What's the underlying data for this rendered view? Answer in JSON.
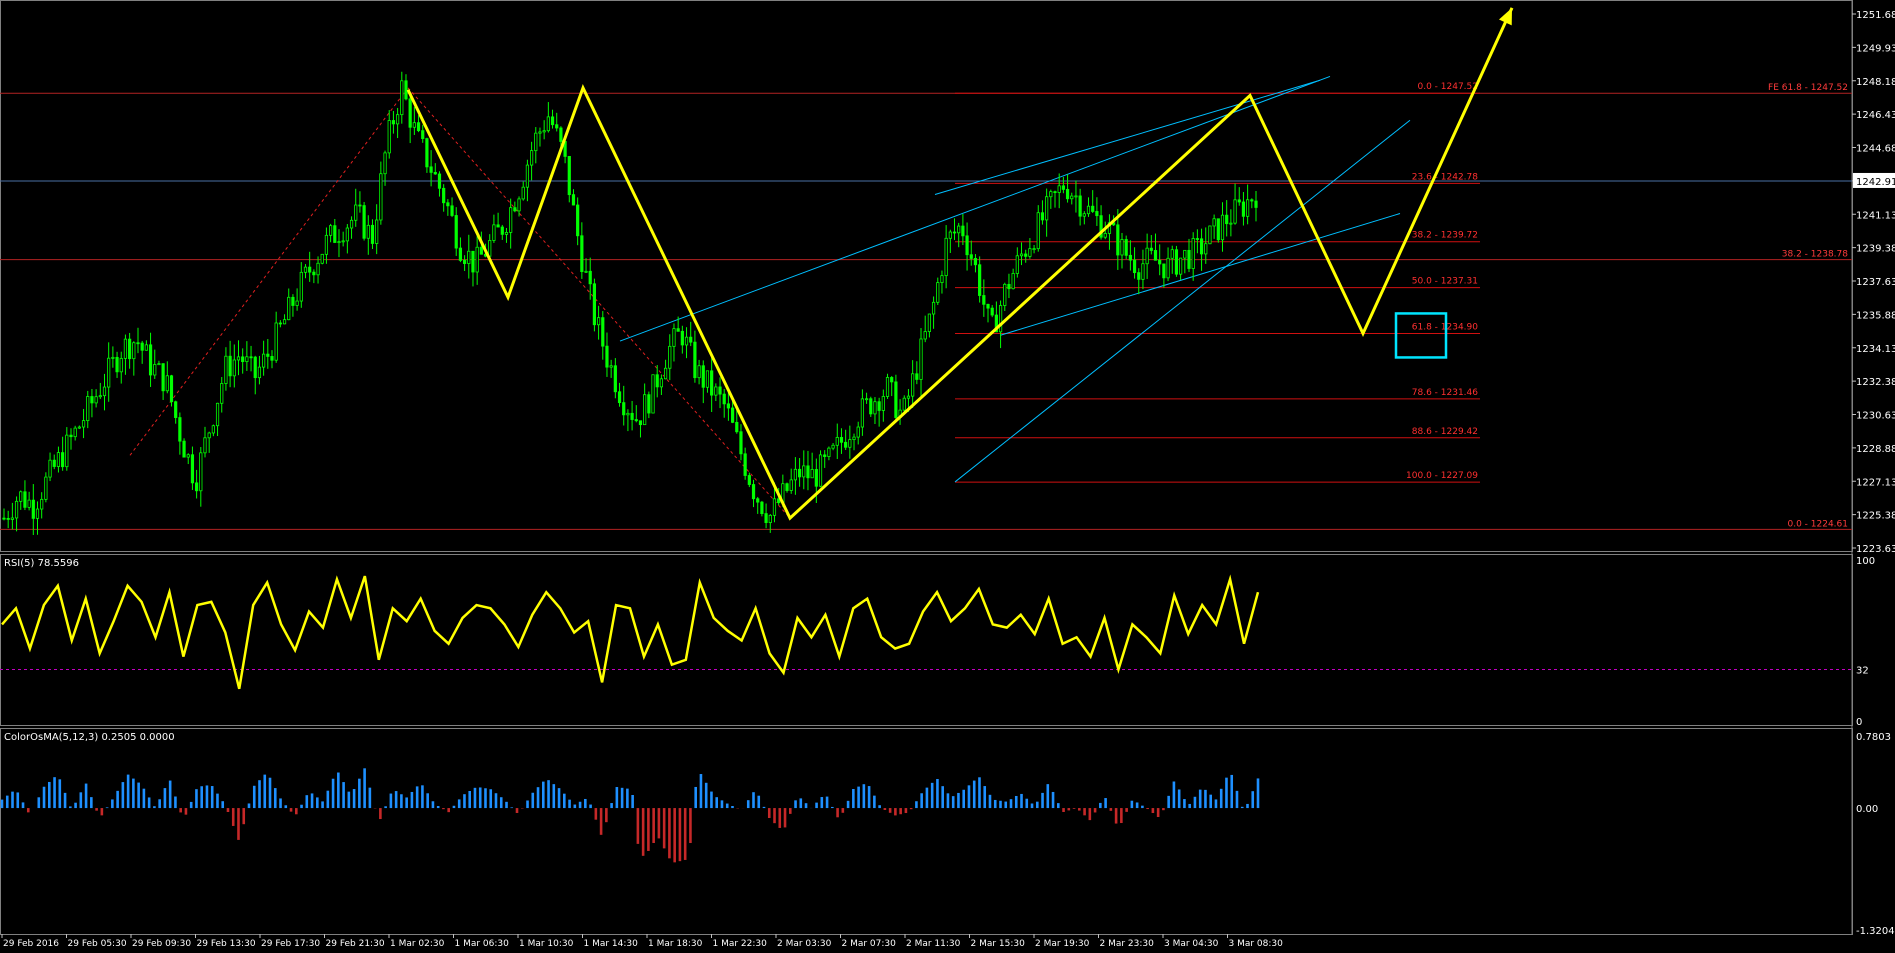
{
  "chart_data": [
    {
      "type": "candlestick",
      "title": "",
      "price_axis": {
        "min": 1223.63,
        "max": 1251.68,
        "ticks": [
          "1251.68",
          "1249.93",
          "1248.18",
          "1246.43",
          "1244.68",
          "1242.93",
          "1241.13",
          "1239.38",
          "1237.63",
          "1235.88",
          "1234.13",
          "1232.38",
          "1230.63",
          "1228.88",
          "1227.13",
          "1225.38",
          "1223.63"
        ],
        "current_price_label": "1242.91",
        "current_price": 1242.91
      },
      "time_axis": {
        "labels": [
          "29 Feb 2016",
          "29 Feb 05:30",
          "29 Feb 09:30",
          "29 Feb 13:30",
          "29 Feb 17:30",
          "29 Feb 21:30",
          "1 Mar 02:30",
          "1 Mar 06:30",
          "1 Mar 10:30",
          "1 Mar 14:30",
          "1 Mar 18:30",
          "1 Mar 22:30",
          "2 Mar 03:30",
          "2 Mar 07:30",
          "2 Mar 11:30",
          "2 Mar 15:30",
          "2 Mar 19:30",
          "2 Mar 23:30",
          "3 Mar 04:30",
          "3 Mar 08:30"
        ]
      },
      "price_path": [
        1225.2,
        1226.4,
        1225.9,
        1227.3,
        1228.6,
        1229.9,
        1231.3,
        1232.7,
        1234.1,
        1234.6,
        1233.2,
        1232.4,
        1229.5,
        1227.2,
        1230.1,
        1233.0,
        1233.8,
        1232.6,
        1233.9,
        1235.5,
        1237.2,
        1238.6,
        1239.8,
        1240.5,
        1241.1,
        1239.9,
        1244.9,
        1247.8,
        1245.2,
        1243.6,
        1241.8,
        1239.5,
        1238.5,
        1239.6,
        1240.7,
        1242.6,
        1245.0,
        1246.4,
        1244.2,
        1239.8,
        1236.0,
        1233.5,
        1231.5,
        1230.4,
        1231.8,
        1233.9,
        1235.0,
        1232.9,
        1232.0,
        1231.0,
        1228.7,
        1226.5,
        1225.3,
        1226.5,
        1227.6,
        1227.4,
        1228.2,
        1229.4,
        1230.6,
        1231.4,
        1232.0,
        1230.5,
        1233.2,
        1236.0,
        1239.7,
        1240.6,
        1238.2,
        1234.9,
        1237.2,
        1238.9,
        1240.2,
        1241.6,
        1242.8,
        1241.9,
        1241.0,
        1240.4,
        1239.2,
        1238.5,
        1238.8,
        1238.4,
        1238.9,
        1239.2,
        1240.1,
        1240.9,
        1241.5,
        1242.3
      ],
      "horizontal_levels": [
        {
          "price": 1247.52,
          "label": "FE 61.8 - 1247.52",
          "color": "#b22222"
        },
        {
          "price": 1242.91,
          "label": "",
          "color": "#4a6fa5"
        },
        {
          "price": 1238.78,
          "label": "38.2 - 1238.78",
          "color": "#b22222"
        },
        {
          "price": 1224.61,
          "label": "0.0 - 1224.61",
          "color": "#b22222"
        }
      ],
      "fibonacci_retracement": [
        {
          "label": "0.0 - 1247.52",
          "price": 1247.52
        },
        {
          "label": "23.6 - 1242.78",
          "price": 1242.78
        },
        {
          "label": "38.2 - 1239.72",
          "price": 1239.72
        },
        {
          "label": "50.0 - 1237.31",
          "price": 1237.31
        },
        {
          "label": "61.8 - 1234.90",
          "price": 1234.9
        },
        {
          "label": "78.6 - 1231.46",
          "price": 1231.46
        },
        {
          "label": "88.6 - 1229.42",
          "price": 1229.42
        },
        {
          "label": "100.0 - 1227.09",
          "price": 1227.09
        }
      ],
      "zigzag_projection": [
        {
          "x": "1 Mar 02:30",
          "y": 1247.7
        },
        {
          "x": "1 Mar 10:30",
          "y": 1236.8
        },
        {
          "x": "1 Mar 14:30",
          "y": 1247.8
        },
        {
          "x": "2 Mar 03:30",
          "y": 1225.2
        },
        {
          "x": "3 Mar 08:30",
          "y": 1247.4
        },
        {
          "y": 1234.9
        },
        {
          "y": 1252.0
        }
      ],
      "colors": {
        "candle": "#00ff00",
        "zigzag": "#ffff00",
        "fib": "#ff0000",
        "trendline": "#00bfff",
        "highlight_box": "#00e5ff",
        "grid": "#808080"
      }
    },
    {
      "type": "line",
      "name": "RSI(5) 78.5596",
      "levels": [
        "100",
        "32",
        "0"
      ],
      "ylim": [
        0,
        100
      ],
      "overlay_level": 32,
      "values": [
        60,
        70,
        45,
        72,
        84,
        50,
        76,
        42,
        62,
        84,
        74,
        52,
        80,
        40,
        72,
        74,
        55,
        20,
        72,
        86,
        60,
        44,
        68,
        58,
        88,
        64,
        90,
        38,
        70,
        62,
        76,
        56,
        48,
        64,
        72,
        70,
        60,
        46,
        66,
        80,
        70,
        55,
        62,
        24,
        72,
        70,
        40,
        60,
        35,
        38,
        86,
        64,
        56,
        50,
        70,
        42,
        30,
        64,
        52,
        66,
        40,
        70,
        76,
        52,
        45,
        48,
        68,
        80,
        62,
        70,
        82,
        60,
        58,
        66,
        54,
        76,
        48,
        52,
        40,
        64,
        32,
        60,
        52,
        42,
        78,
        54,
        72,
        60,
        88,
        48,
        80
      ],
      "color": "#ffff00"
    },
    {
      "type": "bar",
      "name": "ColorOsMA(5,12,3) 0.2505 0.0000",
      "levels": [
        "0.7803",
        "0.00",
        "-1.3204"
      ],
      "ylim": [
        -1.3204,
        0.7803
      ],
      "positive_color": "#1e90ff",
      "negative_color": "#c62828"
    }
  ]
}
